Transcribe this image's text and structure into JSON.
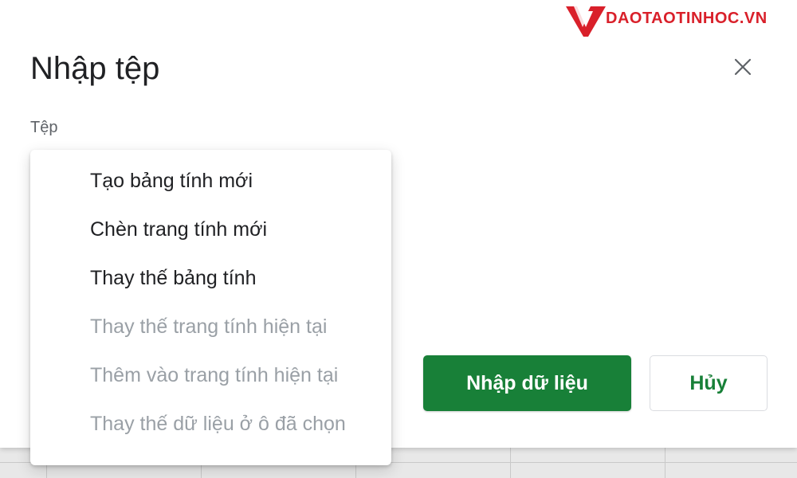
{
  "watermark": {
    "brand_text": "DAOTAOTINHOC.VN",
    "brand_color": "#d9202a"
  },
  "dialog": {
    "title": "Nhập tệp",
    "close_icon": "close-icon",
    "file_label": "Tệp"
  },
  "dropdown": {
    "items": [
      {
        "label": "Tạo bảng tính mới",
        "enabled": true
      },
      {
        "label": "Chèn trang tính mới",
        "enabled": true
      },
      {
        "label": "Thay thế bảng tính",
        "enabled": true
      },
      {
        "label": "Thay thế trang tính hiện tại",
        "enabled": false
      },
      {
        "label": "Thêm vào trang tính hiện tại",
        "enabled": false
      },
      {
        "label": "Thay thế dữ liệu ở ô đã chọn",
        "enabled": false
      }
    ]
  },
  "actions": {
    "import_label": "Nhập dữ liệu",
    "cancel_label": "Hủy",
    "primary_color": "#188038"
  }
}
